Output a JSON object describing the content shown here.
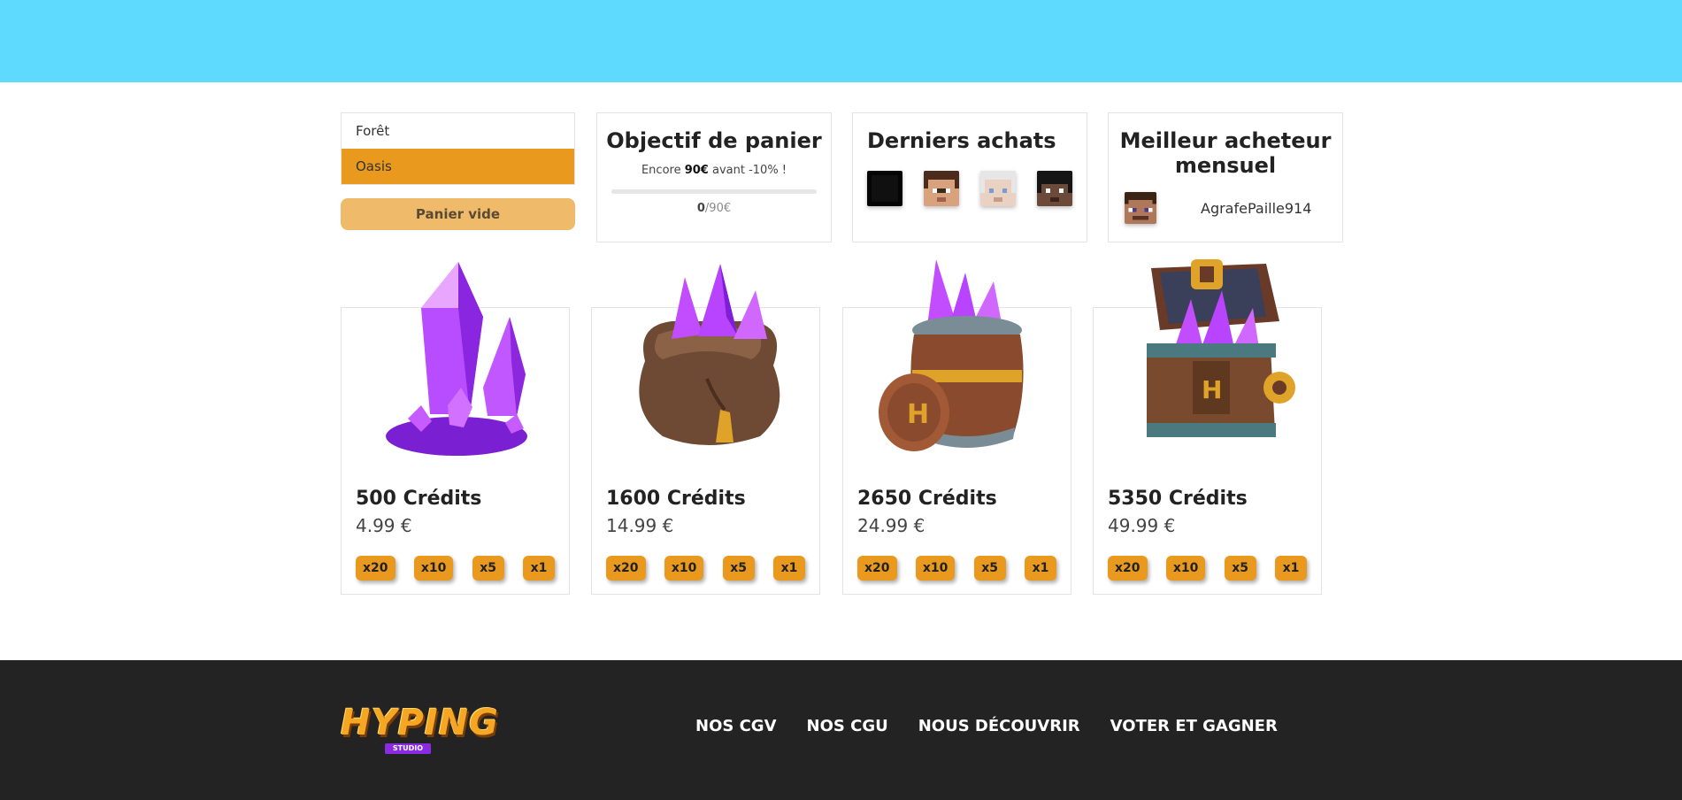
{
  "servers": [
    {
      "label": "Forêt",
      "active": false
    },
    {
      "label": "Oasis",
      "active": true
    }
  ],
  "cart": {
    "empty_label": "Panier vide"
  },
  "goal": {
    "title": "Objectif de panier",
    "sub_prefix": "Encore ",
    "sub_amount": "90€",
    "sub_suffix": " avant -10% !",
    "progress": 0,
    "current": "0",
    "target": "/90€"
  },
  "recent": {
    "title": "Derniers achats",
    "avatars": [
      "dark-skin-avatar",
      "brown-hair-avatar",
      "white-hair-avatar",
      "black-hair-avatar"
    ]
  },
  "best": {
    "title": "Meilleur acheteur mensuel",
    "name": "AgrafePaille914"
  },
  "products": [
    {
      "title": "500 Crédits",
      "price": "4.99 €",
      "icon": "crystals-icon",
      "qty": [
        "x20",
        "x10",
        "x5",
        "x1"
      ]
    },
    {
      "title": "1600 Crédits",
      "price": "14.99 €",
      "icon": "crystal-bag-icon",
      "qty": [
        "x20",
        "x10",
        "x5",
        "x1"
      ]
    },
    {
      "title": "2650 Crédits",
      "price": "24.99 €",
      "icon": "crystal-barrel-icon",
      "qty": [
        "x20",
        "x10",
        "x5",
        "x1"
      ]
    },
    {
      "title": "5350 Crédits",
      "price": "49.99 €",
      "icon": "crystal-chest-icon",
      "qty": [
        "x20",
        "x10",
        "x5",
        "x1"
      ]
    }
  ],
  "footer": {
    "logo": "HYPING",
    "logo_sub": "STUDIO",
    "links": [
      "NOS CGV",
      "NOS CGU",
      "NOUS DÉCOUVRIR",
      "VOTER ET GAGNER"
    ]
  },
  "colors": {
    "topbar": "#5fdaff",
    "accent": "#e99a1e",
    "footer": "#232323"
  }
}
